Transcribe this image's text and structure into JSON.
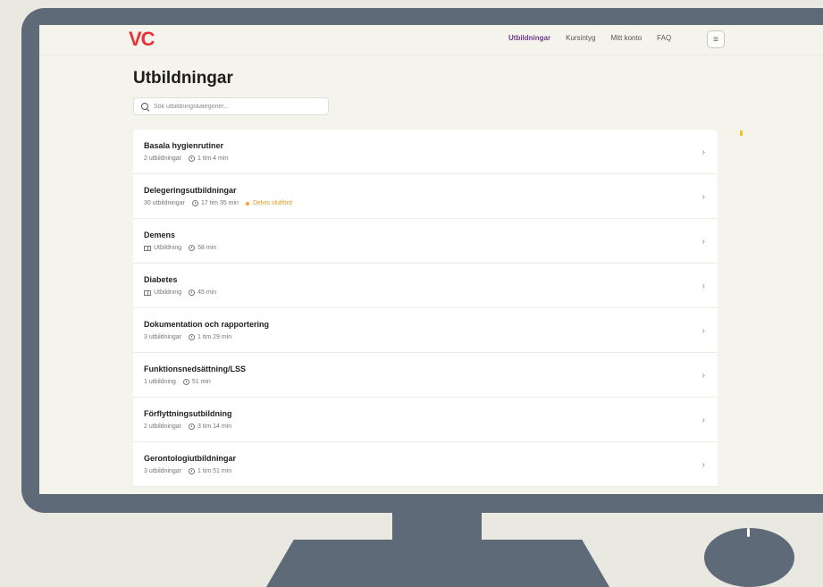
{
  "app": {
    "logo": "VC",
    "nav": [
      {
        "label": "Utbildningar",
        "active": true
      },
      {
        "label": "Kursintyg",
        "active": false
      },
      {
        "label": "Mitt konto",
        "active": false
      },
      {
        "label": "FAQ",
        "active": false
      }
    ],
    "menu_icon": "hamburger-icon"
  },
  "page": {
    "title": "Utbildningar",
    "search_placeholder": "Sök utbildningskategorier..."
  },
  "categories": [
    {
      "title": "Basala hygienrutiner",
      "count": "2 utbildningar",
      "count_icon": "",
      "duration": "1 tim 4 min",
      "status": ""
    },
    {
      "title": "Delegeringsutbildningar",
      "count": "30 utbildningar",
      "count_icon": "",
      "duration": "17 tim 35 min",
      "status": "Delvis slutförd"
    },
    {
      "title": "Demens",
      "count": "Utbildning",
      "count_icon": "book-icon",
      "duration": "58 min",
      "status": ""
    },
    {
      "title": "Diabetes",
      "count": "Utbildning",
      "count_icon": "book-icon",
      "duration": "45 min",
      "status": ""
    },
    {
      "title": "Dokumentation och rapportering",
      "count": "3 utbildningar",
      "count_icon": "",
      "duration": "1 tim 29 min",
      "status": ""
    },
    {
      "title": "Funktionsnedsättning/LSS",
      "count": "1 utbildning",
      "count_icon": "",
      "duration": "51 min",
      "status": ""
    },
    {
      "title": "Förflyttningsutbildning",
      "count": "2 utbildningar",
      "count_icon": "",
      "duration": "3 tim 14 min",
      "status": ""
    },
    {
      "title": "Gerontologiutbildningar",
      "count": "3 utbildningar",
      "count_icon": "",
      "duration": "1 tim 51 min",
      "status": ""
    }
  ],
  "colors": {
    "logo": "#e5343a",
    "nav_active": "#6f3b8f",
    "status": "#f2a71b",
    "frame": "#5e6a78"
  }
}
